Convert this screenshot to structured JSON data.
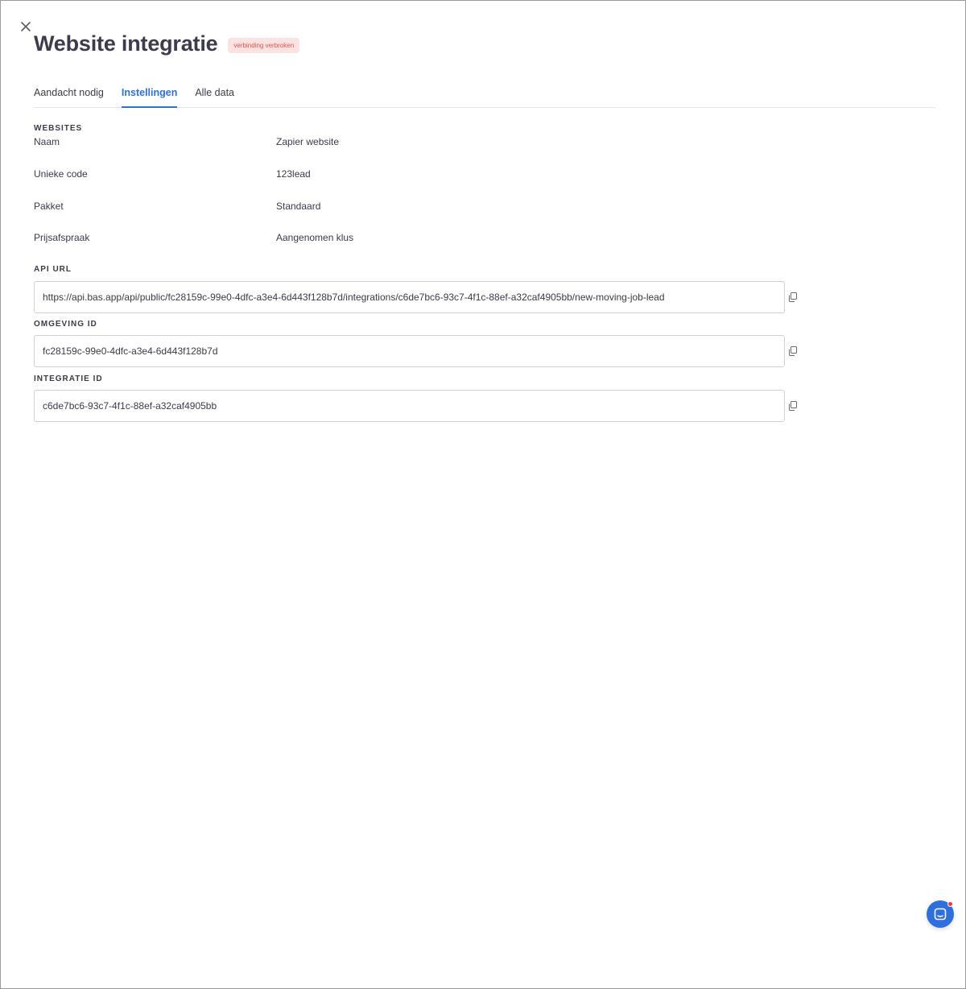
{
  "header": {
    "title": "Website integratie",
    "status_badge": "verbinding verbroken"
  },
  "tabs": [
    {
      "label": "Aandacht nodig",
      "active": false
    },
    {
      "label": "Instellingen",
      "active": true
    },
    {
      "label": "Alle data",
      "active": false
    }
  ],
  "websites": {
    "section_label": "WEBSITES",
    "rows": [
      {
        "label": "Naam",
        "value": "Zapier website"
      },
      {
        "label": "Unieke code",
        "value": "123lead"
      },
      {
        "label": "Pakket",
        "value": "Standaard"
      },
      {
        "label": "Prijsafspraak",
        "value": "Aangenomen klus"
      }
    ]
  },
  "api_url": {
    "section_label": "API URL",
    "value": "https://api.bas.app/api/public/fc28159c-99e0-4dfc-a3e4-6d443f128b7d/integrations/c6de7bc6-93c7-4f1c-88ef-a32caf4905bb/new-moving-job-lead"
  },
  "omgeving_id": {
    "section_label": "OMGEVING ID",
    "value": "fc28159c-99e0-4dfc-a3e4-6d443f128b7d"
  },
  "integratie_id": {
    "section_label": "INTEGRATIE ID",
    "value": "c6de7bc6-93c7-4f1c-88ef-a32caf4905bb"
  },
  "colors": {
    "accent": "#2f6fdc",
    "badge_bg": "#fde2e2",
    "badge_text": "#d9534f",
    "notification_dot": "#e53950"
  },
  "icons": {
    "close": "close-icon",
    "copy": "copy-icon",
    "chat": "chat-icon"
  }
}
